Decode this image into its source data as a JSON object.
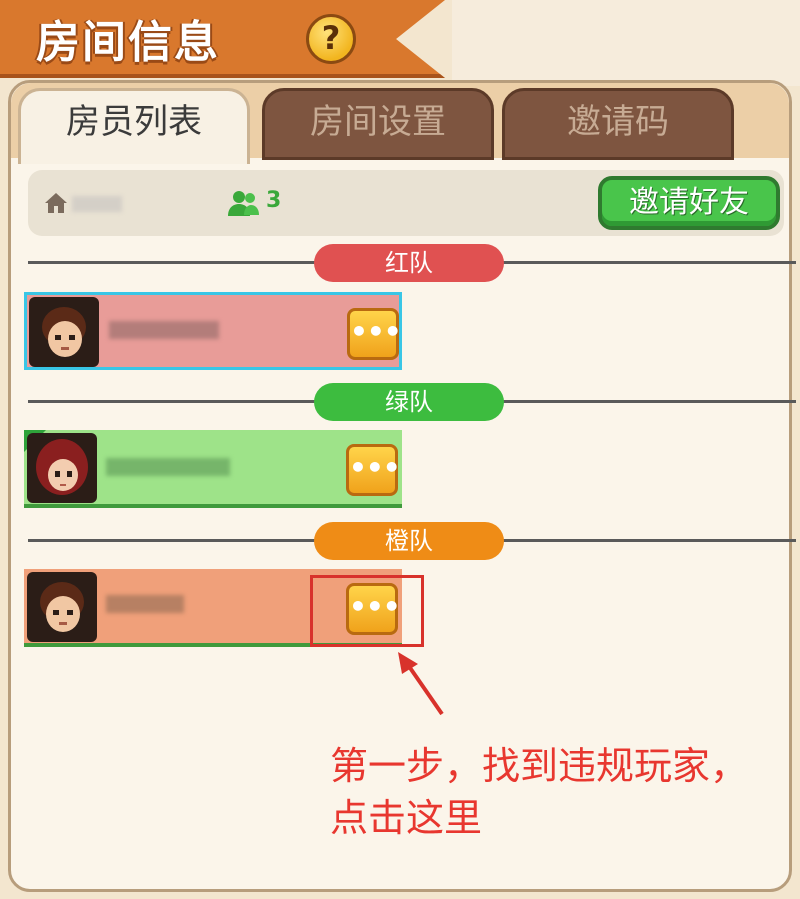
{
  "title": {
    "text": "房间信息",
    "help_icon": "help-icon"
  },
  "tabs": [
    {
      "label": "房员列表",
      "active": true
    },
    {
      "label": "房间设置",
      "active": false
    },
    {
      "label": "邀请码",
      "active": false
    }
  ],
  "room": {
    "home_icon": "home-icon",
    "people_icon": "people-icon",
    "player_count": "3",
    "invite_button_label": "邀请好友"
  },
  "teams": [
    {
      "label": "红队",
      "color": "#e05151",
      "card_color": "#e89c98",
      "selected": true
    },
    {
      "label": "绿队",
      "color": "#3dbc3f",
      "card_color": "#9ee389",
      "selected": false
    },
    {
      "label": "橙队",
      "color": "#ef8c16",
      "card_color": "#f0a07a",
      "selected": false
    }
  ],
  "more_button_glyph": "•••",
  "annotation": {
    "line1": "第一步，找到违规玩家，",
    "line2": "点击这里"
  },
  "colors": {
    "accent_orange": "#d9782d",
    "annotation_red": "#e8372f",
    "invite_green": "#49c54b"
  }
}
